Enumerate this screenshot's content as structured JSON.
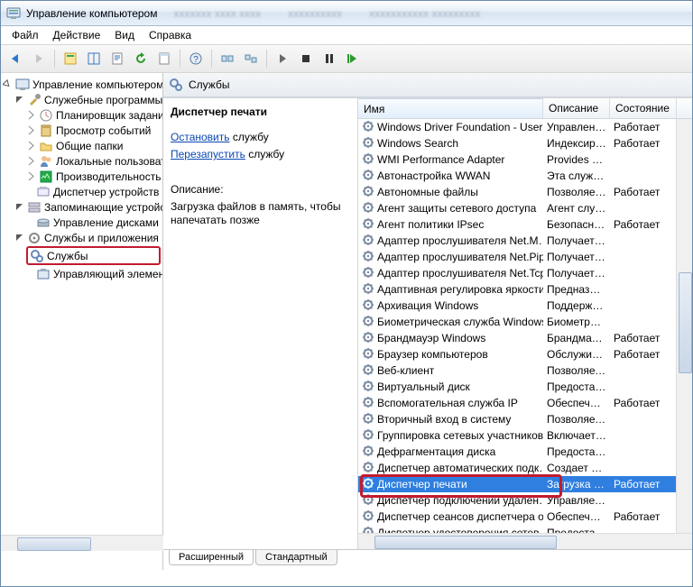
{
  "window": {
    "title": "Управление компьютером"
  },
  "menu": {
    "file": "Файл",
    "action": "Действие",
    "view": "Вид",
    "help": "Справка"
  },
  "tree": {
    "root": "Управление компьютером (л",
    "sysutils": "Служебные программы",
    "scheduler": "Планировщик заданий",
    "events": "Просмотр событий",
    "folders": "Общие папки",
    "users": "Локальные пользовате",
    "perf": "Производительность",
    "devmgr": "Диспетчер устройств",
    "storage": "Запоминающие устройс",
    "diskmgr": "Управление дисками",
    "svcapps": "Службы и приложения",
    "services": "Службы",
    "wmi": "Управляющий элемен"
  },
  "header": {
    "title": "Службы"
  },
  "detail": {
    "name": "Диспетчер печати",
    "stop_lnk": "Остановить",
    "stop_sfx": " службу",
    "restart_lnk": "Перезапустить",
    "restart_sfx": " службу",
    "desc_label": "Описание:",
    "desc_text": "Загрузка файлов в память, чтобы напечатать позже"
  },
  "columns": {
    "name": "Имя",
    "desc": "Описание",
    "state": "Состояние"
  },
  "tabs": {
    "ext": "Расширенный",
    "std": "Стандартный"
  },
  "services": [
    {
      "name": "Windows Driver Foundation - User…",
      "desc": "Управлен…",
      "state": "Работает"
    },
    {
      "name": "Windows Search",
      "desc": "Индексир…",
      "state": "Работает"
    },
    {
      "name": "WMI Performance Adapter",
      "desc": "Provides p…",
      "state": ""
    },
    {
      "name": "Автонастройка WWAN",
      "desc": "Эта служб…",
      "state": ""
    },
    {
      "name": "Автономные файлы",
      "desc": "Позволяе…",
      "state": "Работает"
    },
    {
      "name": "Агент защиты сетевого доступа",
      "desc": "Агент слу…",
      "state": ""
    },
    {
      "name": "Агент политики IPsec",
      "desc": "Безопасно…",
      "state": "Работает"
    },
    {
      "name": "Адаптер прослушивателя Net.M…",
      "desc": "Получает …",
      "state": ""
    },
    {
      "name": "Адаптер прослушивателя Net.Pipe",
      "desc": "Получает …",
      "state": ""
    },
    {
      "name": "Адаптер прослушивателя Net.Tcp",
      "desc": "Получает …",
      "state": ""
    },
    {
      "name": "Адаптивная регулировка яркости",
      "desc": "Предназна…",
      "state": ""
    },
    {
      "name": "Архивация Windows",
      "desc": "Поддержк…",
      "state": ""
    },
    {
      "name": "Биометрическая служба Windows",
      "desc": "Биометри…",
      "state": ""
    },
    {
      "name": "Брандмауэр Windows",
      "desc": "Брандмау…",
      "state": "Работает"
    },
    {
      "name": "Браузер компьютеров",
      "desc": "Обслужив…",
      "state": "Работает"
    },
    {
      "name": "Веб-клиент",
      "desc": "Позволяет…",
      "state": ""
    },
    {
      "name": "Виртуальный диск",
      "desc": "Предостав…",
      "state": ""
    },
    {
      "name": "Вспомогательная служба IP",
      "desc": "Обеспечи…",
      "state": "Работает"
    },
    {
      "name": "Вторичный вход в систему",
      "desc": "Позволяет…",
      "state": ""
    },
    {
      "name": "Группировка сетевых участников",
      "desc": "Включает …",
      "state": ""
    },
    {
      "name": "Дефрагментация диска",
      "desc": "Предостав…",
      "state": ""
    },
    {
      "name": "Диспетчер автоматических подк…",
      "desc": "Создает п…",
      "state": ""
    },
    {
      "name": "Диспетчер печати",
      "desc": "Загрузка …",
      "state": "Работает",
      "sel": true
    },
    {
      "name": "Диспетчер подключений удален…",
      "desc": "Управляет…",
      "state": ""
    },
    {
      "name": "Диспетчер сеансов диспетчера о…",
      "desc": "Обеспечи…",
      "state": "Работает"
    },
    {
      "name": "Диспетчер удостоверения сетев…",
      "desc": "Предостав…",
      "state": ""
    }
  ]
}
